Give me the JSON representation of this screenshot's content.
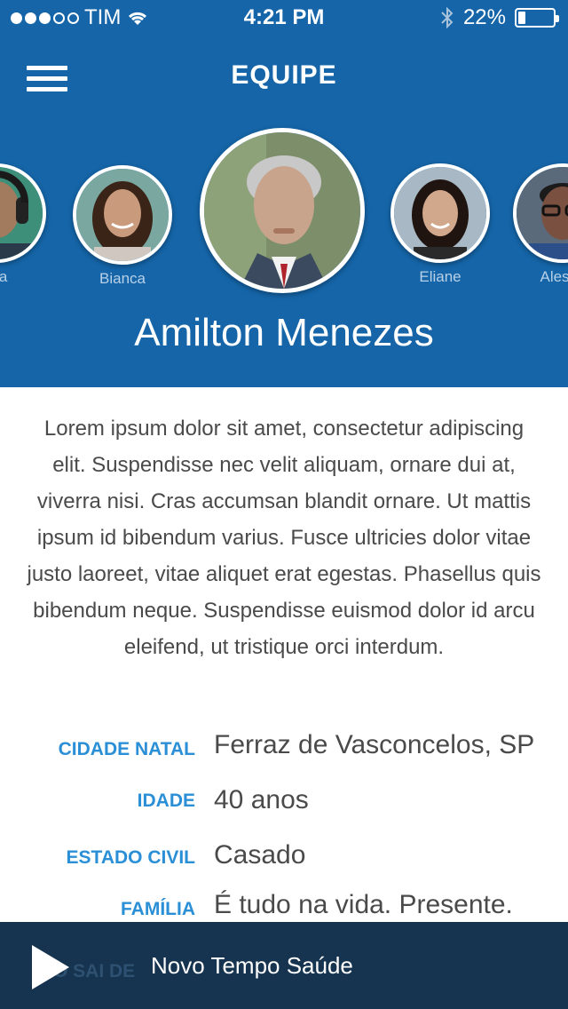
{
  "status": {
    "carrier": "TIM",
    "time": "4:21 PM",
    "battery": "22%",
    "battery_level": 0.22
  },
  "nav": {
    "title": "EQUIPE"
  },
  "team": [
    {
      "name": "Laura",
      "visible_label": "ura",
      "skin": "#a27a5e",
      "bg": "#3d8f7a"
    },
    {
      "name": "Bianca",
      "skin": "#c99a7c",
      "bg": "#7aa7a0"
    },
    {
      "name": "Amilton Menezes",
      "skin": "#c9a48c",
      "bg": "#7d8f6a"
    },
    {
      "name": "Eliane",
      "skin": "#d2a88d",
      "bg": "#a8b8c4"
    },
    {
      "name": "Alessandro",
      "visible_label": "Alessa",
      "skin": "#7a5040",
      "bg": "#5a6a7a"
    }
  ],
  "selected": {
    "name": "Amilton Menezes"
  },
  "bio": "Lorem ipsum dolor sit amet, consectetur adipiscing elit. Suspendisse nec velit aliquam, ornare dui at, viverra nisi. Cras accumsan blandit ornare. Ut mattis ipsum id bibendum varius. Fusce ultricies dolor vitae justo laoreet, vitae aliquet erat egestas. Phasellus quis bibendum neque. Suspendisse euismod dolor id arcu eleifend, ut tristique orci interdum.",
  "details": [
    {
      "label": "CIDADE NATAL",
      "value": "Ferraz de Vasconcelos, SP"
    },
    {
      "label": "IDADE",
      "value": "40 anos"
    },
    {
      "label": "ESTADO CIVIL",
      "value": "Casado"
    },
    {
      "label": "FAMÍLIA",
      "value": "É tudo na vida. Presente."
    }
  ],
  "player": {
    "title": "Novo Tempo Saúde",
    "ghost": "O SAI DE"
  }
}
